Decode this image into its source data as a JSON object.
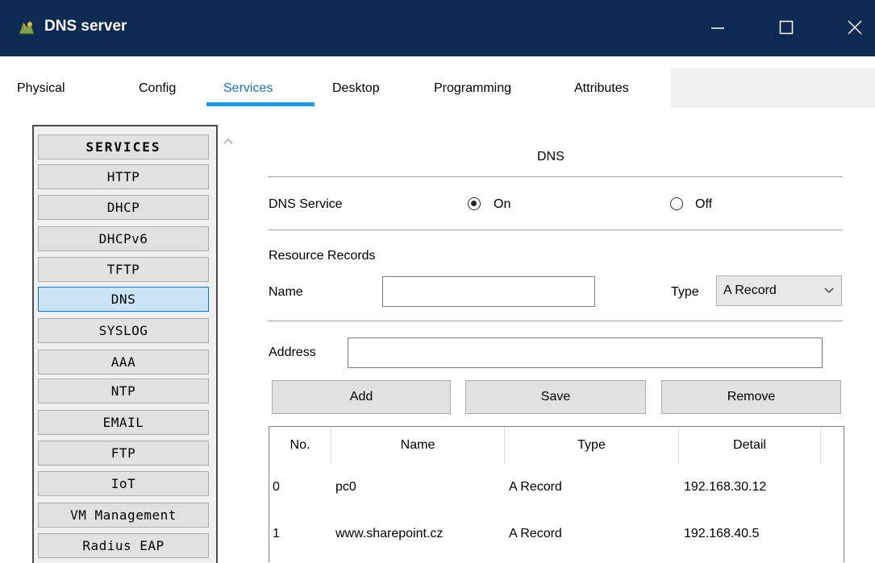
{
  "window": {
    "title": "DNS server",
    "icon": "dns-server-icon"
  },
  "tabs": [
    {
      "label": "Physical"
    },
    {
      "label": "Config"
    },
    {
      "label": "Services",
      "active": true
    },
    {
      "label": "Desktop"
    },
    {
      "label": "Programming"
    },
    {
      "label": "Attributes"
    }
  ],
  "services": {
    "header": "SERVICES",
    "items": [
      "HTTP",
      "DHCP",
      "DHCPv6",
      "TFTP",
      "DNS",
      "SYSLOG",
      "AAA",
      "NTP",
      "EMAIL",
      "FTP",
      "IoT",
      "VM Management",
      "Radius EAP"
    ],
    "selected": "DNS"
  },
  "dns": {
    "section_title": "DNS",
    "service_label": "DNS Service",
    "on_label": "On",
    "off_label": "Off",
    "service_state": "On",
    "resource_records_label": "Resource Records",
    "name_label": "Name",
    "name_value": "",
    "type_label": "Type",
    "type_value": "A Record",
    "address_label": "Address",
    "address_value": "",
    "buttons": {
      "add": "Add",
      "save": "Save",
      "remove": "Remove"
    }
  },
  "records_table": {
    "columns": [
      "No.",
      "Name",
      "Type",
      "Detail"
    ],
    "rows": [
      {
        "no": "0",
        "name": "pc0",
        "type": "A Record",
        "detail": "192.168.30.12"
      },
      {
        "no": "1",
        "name": "www.sharepoint.cz",
        "type": "A Record",
        "detail": "192.168.40.5"
      }
    ]
  },
  "colors": {
    "titlebar": "#0c2a52",
    "active_tab": "#1a73c7",
    "tab_underline": "#1a9ae0",
    "selected_service": "#cce4f7"
  }
}
